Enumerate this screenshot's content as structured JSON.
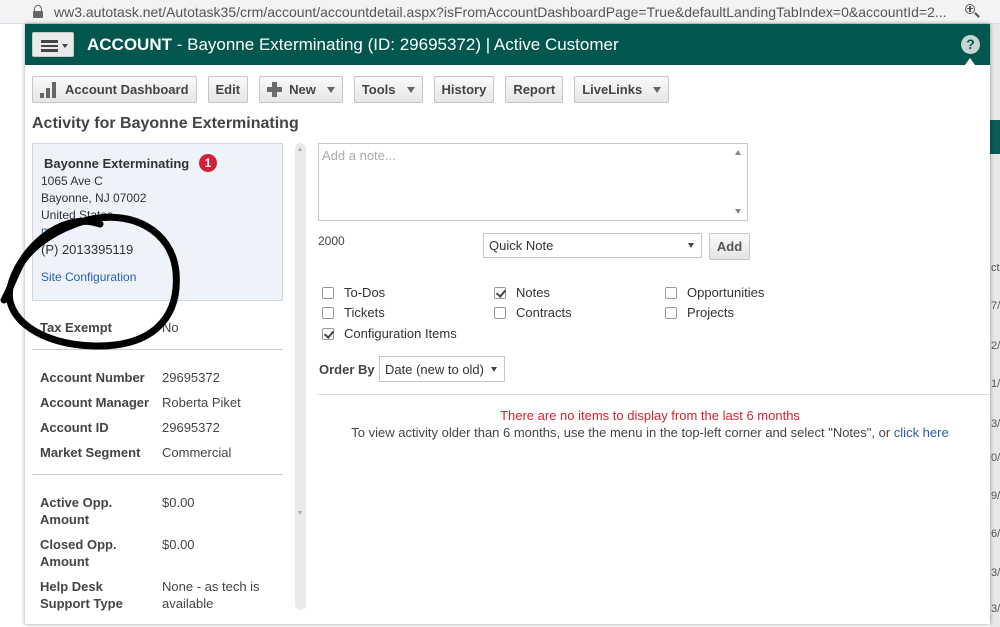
{
  "browser": {
    "url": "ww3.autotask.net/Autotask35/crm/account/accountdetail.aspx?isFromAccountDashboardPage=True&defaultLandingTabIndex=0&accountId=2..."
  },
  "header": {
    "module": "ACCOUNT",
    "subtitle": " - Bayonne Exterminating (ID: 29695372) | Active Customer",
    "help": "?"
  },
  "toolbar": {
    "dashboard": "Account Dashboard",
    "edit": "Edit",
    "new": "New",
    "tools": "Tools",
    "history": "History",
    "report": "Report",
    "livelinks": "LiveLinks"
  },
  "page_heading": "Activity for Bayonne Exterminating",
  "account": {
    "name": "Bayonne Exterminating",
    "badge": "1",
    "address1": "1065 Ave C",
    "address2": "Bayonne, NJ 07002",
    "country": "United States",
    "map": "m",
    "phone": "(P) 2013395119",
    "site_config": "Site Configuration"
  },
  "details": {
    "tax_exempt_label": "Tax Exempt",
    "tax_exempt_value": "No",
    "account_number_label": "Account Number",
    "account_number_value": "29695372",
    "account_manager_label": "Account Manager",
    "account_manager_value": "Roberta Piket",
    "account_id_label": "Account ID",
    "account_id_value": "29695372",
    "market_segment_label": "Market Segment",
    "market_segment_value": "Commercial",
    "active_opp_label_1": "Active Opp.",
    "active_opp_label_2": "Amount",
    "active_opp_value": "$0.00",
    "closed_opp_label_1": "Closed Opp.",
    "closed_opp_label_2": "Amount",
    "closed_opp_value": "$0.00",
    "help_desk_label_1": "Help Desk",
    "help_desk_label_2": "Support Type",
    "help_desk_value_1": "None - as tech is",
    "help_desk_value_2": "available"
  },
  "note": {
    "placeholder": "Add a note...",
    "char_count": "2000",
    "type_selected": "Quick Note",
    "add_label": "Add"
  },
  "filters": {
    "todos": "To-Dos",
    "notes": "Notes",
    "opportunities": "Opportunities",
    "tickets": "Tickets",
    "contracts": "Contracts",
    "projects": "Projects",
    "config_items": "Configuration Items"
  },
  "order_by": {
    "label": "Order By",
    "selected": "Date (new to old)"
  },
  "messages": {
    "empty": "There are no items to display from the last 6 months",
    "older_prefix": "To view activity older than 6 months, use the menu in the top-left corner and select \"Notes\", or ",
    "older_link": "click here"
  },
  "background_marks": [
    "ct",
    "7/",
    "2/",
    "1/",
    "3/",
    "0/",
    "9/",
    "6/",
    "3/",
    "3/"
  ],
  "colors": {
    "header_bg": "#01574e",
    "link": "#2a5ea8",
    "alert_red": "#d4212e",
    "badge_red": "#d41f3b"
  }
}
